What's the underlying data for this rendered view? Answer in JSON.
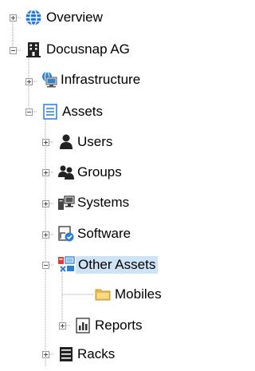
{
  "tree": {
    "items": [
      {
        "label": "Overview",
        "icon": "globe-icon"
      },
      {
        "label": "Docusnap AG",
        "icon": "building-icon"
      },
      {
        "label": "Infrastructure",
        "icon": "network-computer-icon"
      },
      {
        "label": "Assets",
        "icon": "assets-list-icon"
      },
      {
        "label": "Users",
        "icon": "user-icon"
      },
      {
        "label": "Groups",
        "icon": "group-icon"
      },
      {
        "label": "Systems",
        "icon": "systems-icon"
      },
      {
        "label": "Software",
        "icon": "software-icon"
      },
      {
        "label": "Other Assets",
        "icon": "other-assets-icon",
        "selected": true
      },
      {
        "label": "Mobiles",
        "icon": "folder-icon"
      },
      {
        "label": "Reports",
        "icon": "reports-icon"
      },
      {
        "label": "Racks",
        "icon": "rack-icon"
      }
    ]
  },
  "colors": {
    "selection": "#cfe3f7",
    "globe": "#1a73e8",
    "folder": "#e8b94a"
  }
}
